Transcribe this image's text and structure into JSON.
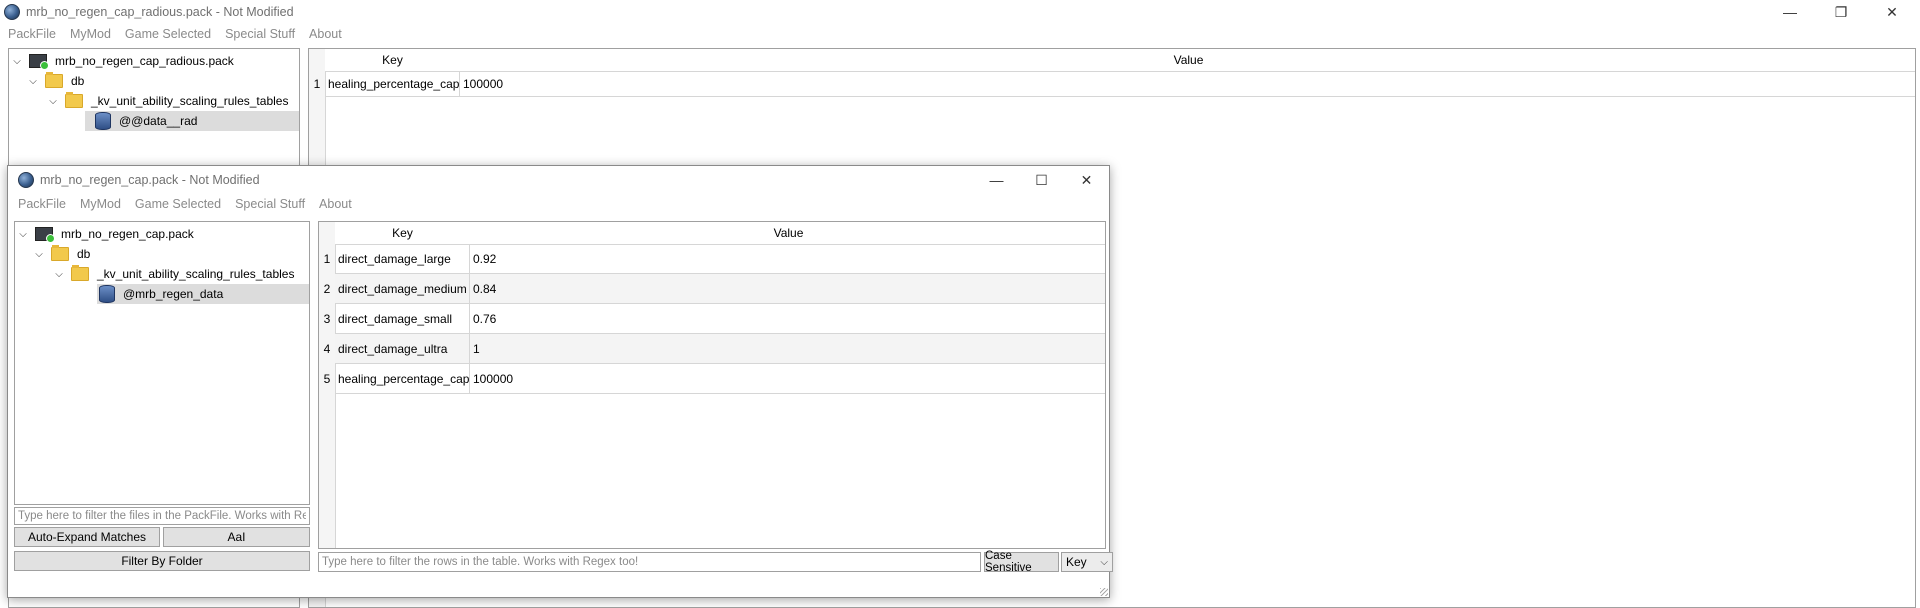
{
  "main_window": {
    "title": "mrb_no_regen_cap_radious.pack - Not Modified",
    "controls": {
      "minimize": "—",
      "restore": "❐",
      "close": "✕"
    },
    "menu": [
      "PackFile",
      "MyMod",
      "Game Selected",
      "Special Stuff",
      "About"
    ],
    "tree": [
      {
        "label": "mrb_no_regen_cap_radious.pack",
        "type": "pack",
        "expanded": true
      },
      {
        "label": "db",
        "type": "folder",
        "expanded": true
      },
      {
        "label": "_kv_unit_ability_scaling_rules_tables",
        "type": "folder",
        "expanded": true
      },
      {
        "label": "@@data__rad",
        "type": "table",
        "selected": true
      }
    ],
    "table": {
      "headers": {
        "key": "Key",
        "value": "Value"
      },
      "rows": [
        {
          "num": "1",
          "key": "healing_percentage_cap",
          "value": "100000"
        }
      ]
    }
  },
  "sub_window": {
    "title": "mrb_no_regen_cap.pack - Not Modified",
    "controls": {
      "minimize": "—",
      "maximize": "☐",
      "close": "✕"
    },
    "menu": [
      "PackFile",
      "MyMod",
      "Game Selected",
      "Special Stuff",
      "About"
    ],
    "tree": [
      {
        "label": "mrb_no_regen_cap.pack",
        "type": "pack",
        "expanded": true
      },
      {
        "label": "db",
        "type": "folder",
        "expanded": true
      },
      {
        "label": "_kv_unit_ability_scaling_rules_tables",
        "type": "folder",
        "expanded": true
      },
      {
        "label": "@mrb_regen_data",
        "type": "table",
        "selected": true
      }
    ],
    "file_filter_placeholder": "Type here to filter the files in the PackFile. Works with Re...",
    "auto_expand_label": "Auto-Expand Matches",
    "case_label": "AaI",
    "filter_folder_label": "Filter By Folder",
    "table": {
      "headers": {
        "key": "Key",
        "value": "Value"
      },
      "rows": [
        {
          "num": "1",
          "key": "direct_damage_large",
          "value": "0.92"
        },
        {
          "num": "2",
          "key": "direct_damage_medium",
          "value": "0.84"
        },
        {
          "num": "3",
          "key": "direct_damage_small",
          "value": "0.76"
        },
        {
          "num": "4",
          "key": "direct_damage_ultra",
          "value": "1"
        },
        {
          "num": "5",
          "key": "healing_percentage_cap",
          "value": "100000"
        }
      ]
    },
    "row_filter_placeholder": "Type here to filter the rows in the table. Works with Regex too!",
    "case_sensitive_label": "Case Sensitive",
    "column_select_value": "Key"
  }
}
